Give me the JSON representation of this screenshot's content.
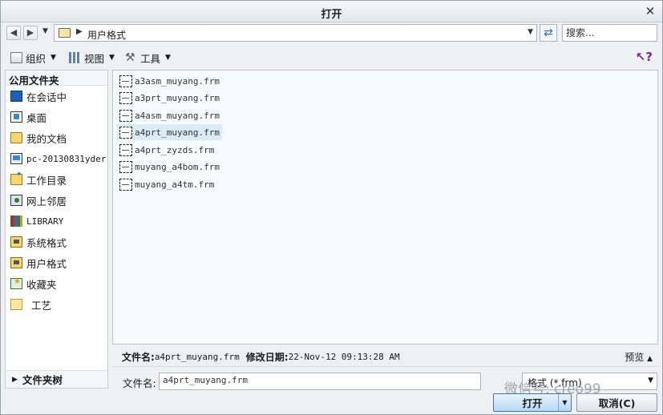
{
  "window": {
    "title": "打开",
    "close_icon": "close-icon"
  },
  "nav": {
    "back_icon": "arrow-left-icon",
    "forward_icon": "arrow-right-icon"
  },
  "address": {
    "path": "用户格式"
  },
  "search": {
    "placeholder": "搜索..."
  },
  "toolbar": {
    "organize": "组织",
    "view": "视图",
    "tools": "工具"
  },
  "sidebar": {
    "header": "公用文件夹",
    "items": [
      {
        "label": "在会话中",
        "icon": "session-icon"
      },
      {
        "label": "桌面",
        "icon": "desktop-icon"
      },
      {
        "label": "我的文档",
        "icon": "documents-icon"
      },
      {
        "label": "pc-20130831yder",
        "icon": "computer-icon"
      },
      {
        "label": "工作目录",
        "icon": "working-directory-icon"
      },
      {
        "label": "网上邻居",
        "icon": "network-icon"
      },
      {
        "label": "LIBRARY",
        "icon": "library-icon"
      },
      {
        "label": "系统格式",
        "icon": "folder-icon"
      },
      {
        "label": "用户格式",
        "icon": "folder-icon"
      },
      {
        "label": "收藏夹",
        "icon": "favorites-icon"
      },
      {
        "label": "工艺",
        "icon": "folder-icon"
      }
    ],
    "footer": "文件夹树"
  },
  "files": [
    {
      "name": "a3asm_muyang.frm",
      "selected": false
    },
    {
      "name": "a3prt_muyang.frm",
      "selected": false
    },
    {
      "name": "a4asm_muyang.frm",
      "selected": false
    },
    {
      "name": "a4prt_muyang.frm",
      "selected": true
    },
    {
      "name": "a4prt_zyzds.frm",
      "selected": false
    },
    {
      "name": "muyang_a4bom.frm",
      "selected": false
    },
    {
      "name": "muyang_a4tm.frm",
      "selected": false
    }
  ],
  "info": {
    "filename_label": "文件名:",
    "filename_value": "a4prt_muyang.frm",
    "modified_label": "修改日期:",
    "modified_value": "22-Nov-12 09:13:28 AM",
    "preview": "预览"
  },
  "footer": {
    "filename_label": "文件名:",
    "filename_value": "a4prt_muyang.frm",
    "type_value": "格式 (*.frm)",
    "watermark": "微信号: creo99",
    "open": "打开",
    "cancel": "取消(C)"
  }
}
